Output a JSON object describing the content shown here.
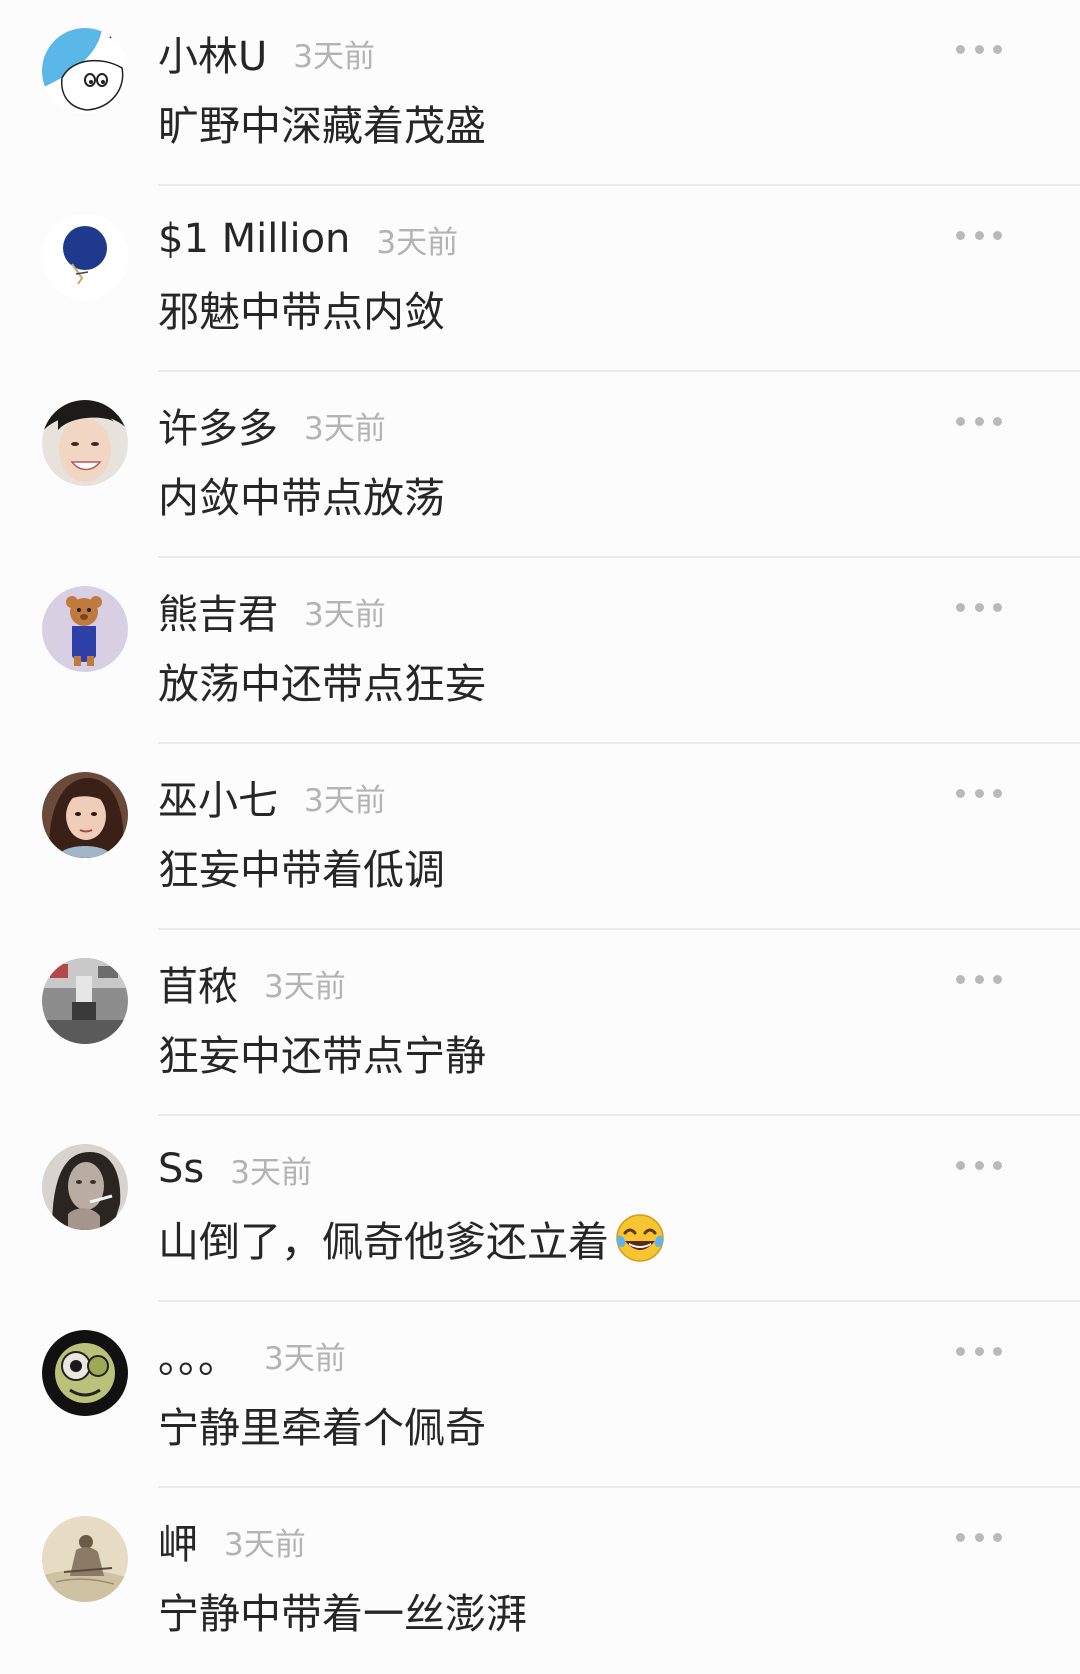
{
  "comments": [
    {
      "name": "小林U",
      "time": "3天前",
      "text": "旷野中深藏着茂盛",
      "avatar": "cartoon-avatar"
    },
    {
      "name": "$1 Million",
      "time": "3天前",
      "text": "邪魅中带点内敛",
      "avatar": "blue-fan-avatar"
    },
    {
      "name": "许多多",
      "time": "3天前",
      "text": "内敛中带点放荡",
      "avatar": "smiling-face-avatar"
    },
    {
      "name": "熊吉君",
      "time": "3天前",
      "text": "放荡中还带点狂妄",
      "avatar": "bear-avatar"
    },
    {
      "name": "巫小七",
      "time": "3天前",
      "text": "狂妄中带着低调",
      "avatar": "portrait-avatar"
    },
    {
      "name": "苜秾",
      "time": "3天前",
      "text": "狂妄中还带点宁静",
      "avatar": "photo-avatar"
    },
    {
      "name": "Ss",
      "time": "3天前",
      "text": "山倒了，佩奇他爹还立着",
      "avatar": "bw-portrait-avatar",
      "emoji": "tears-of-joy-emoji"
    },
    {
      "name": "。。。",
      "time": "3天前",
      "text": "宁静里牵着个佩奇",
      "avatar": "alien-avatar"
    },
    {
      "name": "岬",
      "time": "3天前",
      "text": "宁静中带着一丝澎湃",
      "avatar": "painting-avatar"
    }
  ],
  "colors": {
    "name": "#262626",
    "time": "#b3b3b3",
    "divider": "#ececec",
    "more_dots": "#b9b9b9"
  }
}
